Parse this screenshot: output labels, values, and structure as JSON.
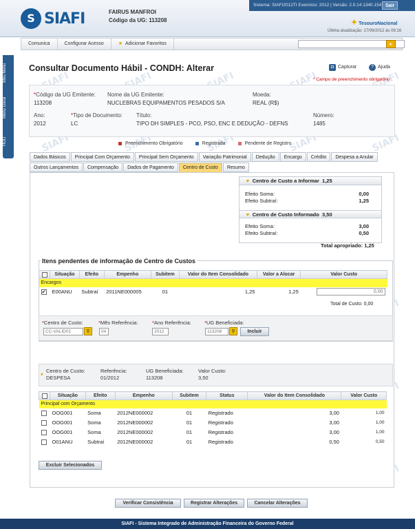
{
  "brand": {
    "logo": "SIAFI",
    "tesouro": "TesouroNacional"
  },
  "user": {
    "name": "FAIRUS MANFROI",
    "ug": "Código da UG: 113208"
  },
  "system": {
    "info": "Sistema: SIAFI2012TI  Exercício: 2012 | Versão: 2.0.14.1340.154",
    "logout": "Sair",
    "last_update": "Última atualização: 17/09/2012 às 09:16"
  },
  "menu": {
    "items": [
      "Comunica",
      "Configurar Acesso",
      "Adicionar Favoritos"
    ],
    "search_placeholder": ""
  },
  "side": [
    "Meu Menu",
    "Menu Geral",
    "HOD"
  ],
  "page": {
    "title": "Consultar Documento Hábil - CONDH: Alterar",
    "capture": "Capturar",
    "help": "Ajuda",
    "required_note": "* Campo de preenchimento obrigatório"
  },
  "doc": {
    "ug_emitente": {
      "label": "Código da UG Emitente:",
      "value": "113208"
    },
    "nome_ug": {
      "label": "Nome da UG Emitente:",
      "value": "NUCLEBRAS EQUIPAMENTOS PESADOS S/A"
    },
    "moeda": {
      "label": "Moeda:",
      "value": "REAL (R$)"
    },
    "ano": {
      "label": "Ano:",
      "value": "2012"
    },
    "tipo": {
      "label": "Tipo de Documento:",
      "value": "LC"
    },
    "titulo": {
      "label": "Título:",
      "value": "TIPO DH SIMPLES - PCO, PSO, ENC E DEDUÇÃO - DEFNS"
    },
    "numero": {
      "label": "Número:",
      "value": "1485"
    }
  },
  "legend": {
    "obrig": "Preenchimento Obrigatório",
    "reg": "Registrada",
    "pend": "Pendente de Registro",
    "colors": {
      "obrig": "#c0392b",
      "reg": "#3a6ea5",
      "pend": "#d86c6c"
    }
  },
  "tabs_row1": [
    "Dados Básicos",
    "Principal Com Orçamento",
    "Principal Sem Orçamento",
    "Variação Patrimonial",
    "Dedução",
    "Encargo",
    "Crédito",
    "Despesa a Anular"
  ],
  "tabs_row2": [
    "Outros Lançamentos",
    "Compensação",
    "Dados de Pagamento",
    "Centro de Custo",
    "Resumo"
  ],
  "cc_summary": {
    "informar": {
      "title": "Centro de Custo a Informar",
      "value": "1,25",
      "efeito_soma_label": "Efeito Soma:",
      "efeito_soma": "0,00",
      "efeito_subtrai_label": "Efeito Subtraí:",
      "efeito_subtrai": "1,25"
    },
    "informado": {
      "title": "Centro de Custo Informado",
      "value": "3,50",
      "efeito_soma_label": "Efeito Soma:",
      "efeito_soma": "3,00",
      "efeito_subtrai_label": "Efeito Subtraí:",
      "efeito_subtrai": "0,50"
    },
    "total_label": "Total apropriado:",
    "total": "1,25"
  },
  "pendentes": {
    "title": "Itens pendentes de informação de Centro de Custos",
    "headers": [
      "Situação",
      "Efeito",
      "Empenho",
      "Subitem",
      "Valor do Item Consolidado",
      "Valor a Alocar",
      "Valor Custo"
    ],
    "group": "Encargos",
    "rows": [
      {
        "checked": "✔",
        "situacao": "E00ANU",
        "efeito": "Subtraí",
        "empenho": "2011NE000005",
        "subitem": "01",
        "consolidado": "1,25",
        "alocar": "1,25",
        "custo": "0,00"
      }
    ],
    "total_label": "Total de Custo:",
    "total": "0,00"
  },
  "form": {
    "cc_label": "Centro de Custo:",
    "cc_value": "CC-VALID01",
    "mes_label": "Mês Referência:",
    "mes_value": "04",
    "ano_label": "Ano Referência:",
    "ano_value": "2012",
    "ug_label": "UG Beneficiada:",
    "ug_value": "113208",
    "incluir": "Incluir"
  },
  "cc_detail": {
    "cc_label": "Centro de Custo:",
    "cc_value": "DESPESA",
    "ref_label": "Referência:",
    "ref_value": "01/2012",
    "ug_label": "UG Beneficiada:",
    "ug_value": "113208",
    "vc_label": "Valor Custo:",
    "vc_value": "3,50"
  },
  "alocados": {
    "headers": [
      "Situação",
      "Efeito",
      "Empenho",
      "Subitem",
      "Status",
      "Valor do Item Consolidado",
      "Valor Custo"
    ],
    "group": "Principal com Orçamento",
    "rows": [
      {
        "situacao": "OOG001",
        "efeito": "Soma",
        "empenho": "2012NE000002",
        "subitem": "01",
        "status": "Registrado",
        "consolidado": "3,00",
        "custo": "1,00"
      },
      {
        "situacao": "OOG001",
        "efeito": "Soma",
        "empenho": "2012NE000002",
        "subitem": "01",
        "status": "Registrado",
        "consolidado": "3,00",
        "custo": "1,00"
      },
      {
        "situacao": "OOG001",
        "efeito": "Soma",
        "empenho": "2012NE000002",
        "subitem": "01",
        "status": "Registrado",
        "consolidado": "3,00",
        "custo": "1,00"
      },
      {
        "situacao": "O01ANU",
        "efeito": "Subtraí",
        "empenho": "2012NE000002",
        "subitem": "01",
        "status": "Registrado",
        "consolidado": "0,50",
        "custo": "0,50"
      }
    ],
    "excluir": "Excluir Selecionados"
  },
  "actions": {
    "verificar": "Verificar Consistência",
    "registrar": "Registrar Alterações",
    "cancelar": "Cancelar Alterações"
  },
  "footer": "SIAFI - Sistema Integrado de Administração Financeira do Governo Federal"
}
